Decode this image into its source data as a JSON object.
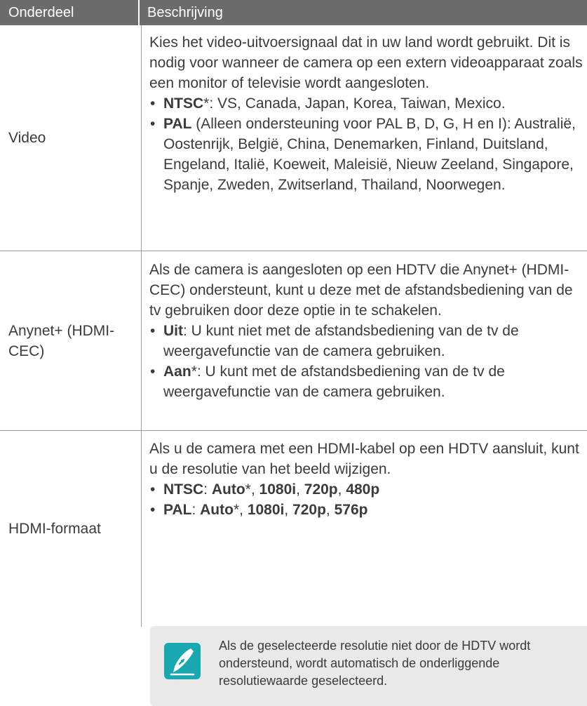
{
  "header": {
    "col1": "Onderdeel",
    "col2": "Beschrijving"
  },
  "video": {
    "label": "Video",
    "intro": "Kies het video-uitvoersignaal dat in uw land wordt gebruikt. Dit is nodig voor wanneer de camera op een extern videoapparaat zoals een monitor of televisie wordt aangesloten.",
    "ntsc_term": "NTSC",
    "ntsc_text": "*: VS, Canada, Japan, Korea, Taiwan, Mexico.",
    "pal_term": "PAL",
    "pal_text": " (Alleen ondersteuning voor PAL B, D, G, H en I): Australië, Oostenrijk, België, China, Denemarken, Finland, Duitsland, Engeland, Italië, Koeweit, Maleisië, Nieuw Zeeland, Singapore, Spanje, Zweden, Zwitserland, Thailand, Noorwegen."
  },
  "anynet": {
    "label": "Anynet+ (HDMI-CEC)",
    "intro": "Als de camera is aangesloten op een HDTV die Anynet+ (HDMI-CEC) ondersteunt, kunt u deze met de afstandsbediening van de tv gebruiken door deze optie in te schakelen.",
    "off_term": "Uit",
    "off_text": ": U kunt niet met de afstandsbediening van de tv de weergavefunctie van de camera gebruiken.",
    "on_term": "Aan",
    "on_text": "*: U kunt met de afstandsbediening van de tv de weergavefunctie van de camera gebruiken."
  },
  "hdmi": {
    "label": "HDMI-formaat",
    "intro": "Als u de camera met een HDMI-kabel op een HDTV aansluit, kunt u de resolutie van het beeld wijzigen.",
    "ntsc_term": "NTSC",
    "ntsc_options": [
      "Auto",
      "1080i",
      "720p",
      "480p"
    ],
    "pal_term": "PAL",
    "pal_options": [
      "Auto",
      "1080i",
      "720p",
      "576p"
    ],
    "separator": ": ",
    "comma": ", ",
    "star": "*",
    "note": "Als de geselecteerde resolutie niet door de HDTV wordt ondersteund, wordt automatisch de onderliggende resolutiewaarde geselecteerd.",
    "note_icon": "pencil-note-icon"
  }
}
